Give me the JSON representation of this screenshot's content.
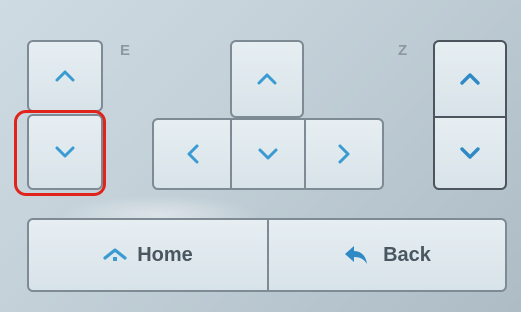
{
  "axes": {
    "e_label": "E",
    "z_label": "Z"
  },
  "buttons": {
    "home_label": "Home",
    "back_label": "Back"
  },
  "icons": {
    "e_up": "chevron-up-icon",
    "e_down": "chevron-down-icon",
    "xy_up": "chevron-up-icon",
    "xy_down": "chevron-down-icon",
    "xy_left": "chevron-left-icon",
    "xy_right": "chevron-right-icon",
    "z_up": "chevron-up-icon",
    "z_down": "chevron-down-icon",
    "home": "home-icon",
    "back": "back-arrow-icon"
  },
  "colors": {
    "accent": "#3a9ad2",
    "highlight": "#e0241b",
    "text": "#4a5660"
  }
}
